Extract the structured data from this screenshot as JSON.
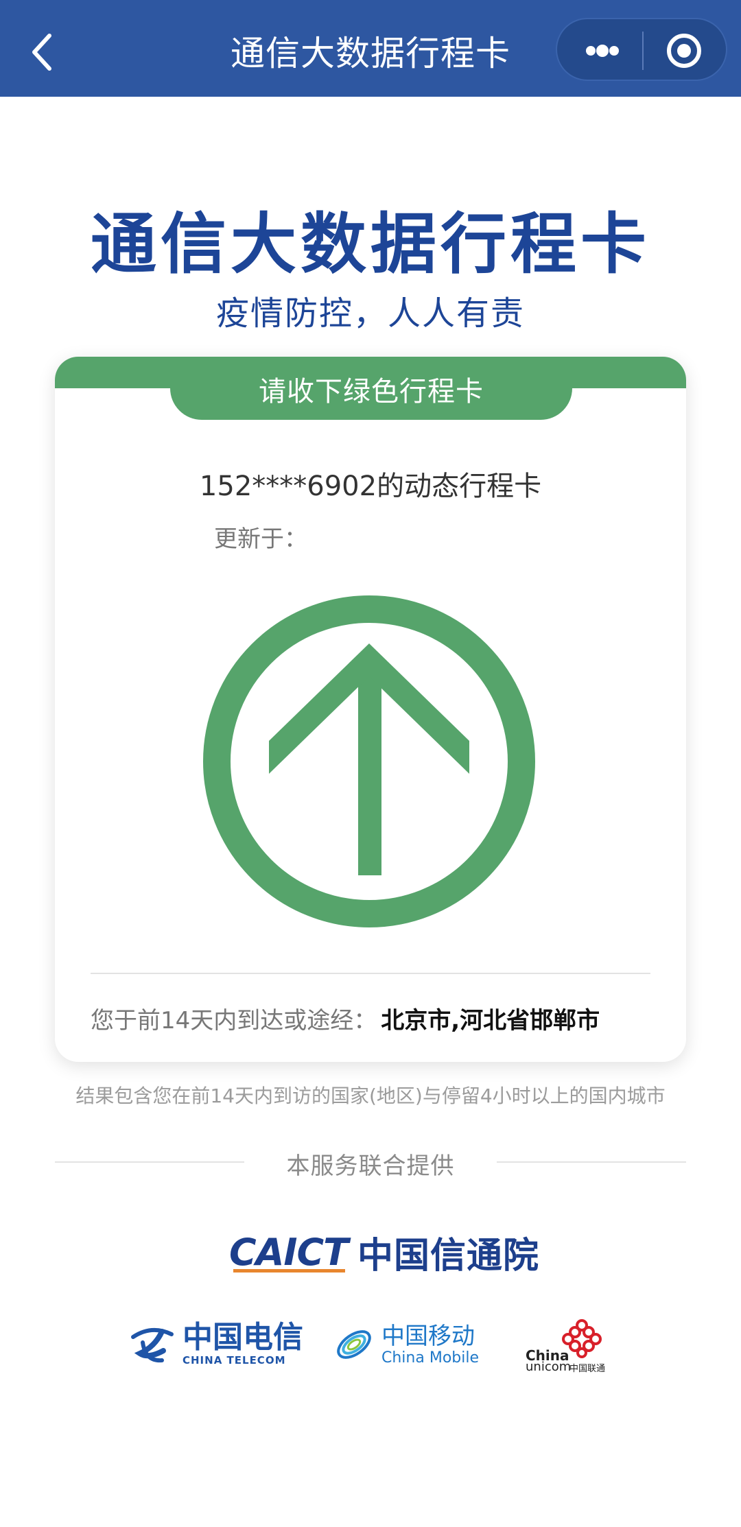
{
  "nav": {
    "title": "通信大数据行程卡"
  },
  "hero": {
    "title": "通信大数据行程卡",
    "subtitle": "疫情防控，人人有责"
  },
  "card": {
    "header": "请收下绿色行程卡",
    "phone_line": "152****6902的动态行程卡",
    "updated_label": "更新于：",
    "status_color": "#56a46b",
    "status_icon": "up-arrow-circle-icon",
    "route_label": "您于前14天内到达或途经：",
    "route_cities": "北京市,河北省邯郸市"
  },
  "note": "结果包含您在前14天内到访的国家(地区)与停留4小时以上的国内城市",
  "providers": {
    "label": "本服务联合提供",
    "caict_mark": "CAICT",
    "caict_cn": "中国信通院",
    "telecom_cn": "中国电信",
    "telecom_en": "CHINA TELECOM",
    "mobile_cn": "中国移动",
    "mobile_en": "China Mobile",
    "unicom_en_1": "China",
    "unicom_en_2": "unicom",
    "unicom_cn": "中国联通"
  },
  "colors": {
    "nav_bg": "#2e57a1",
    "brand_blue": "#1d4597",
    "green": "#56a46b"
  }
}
